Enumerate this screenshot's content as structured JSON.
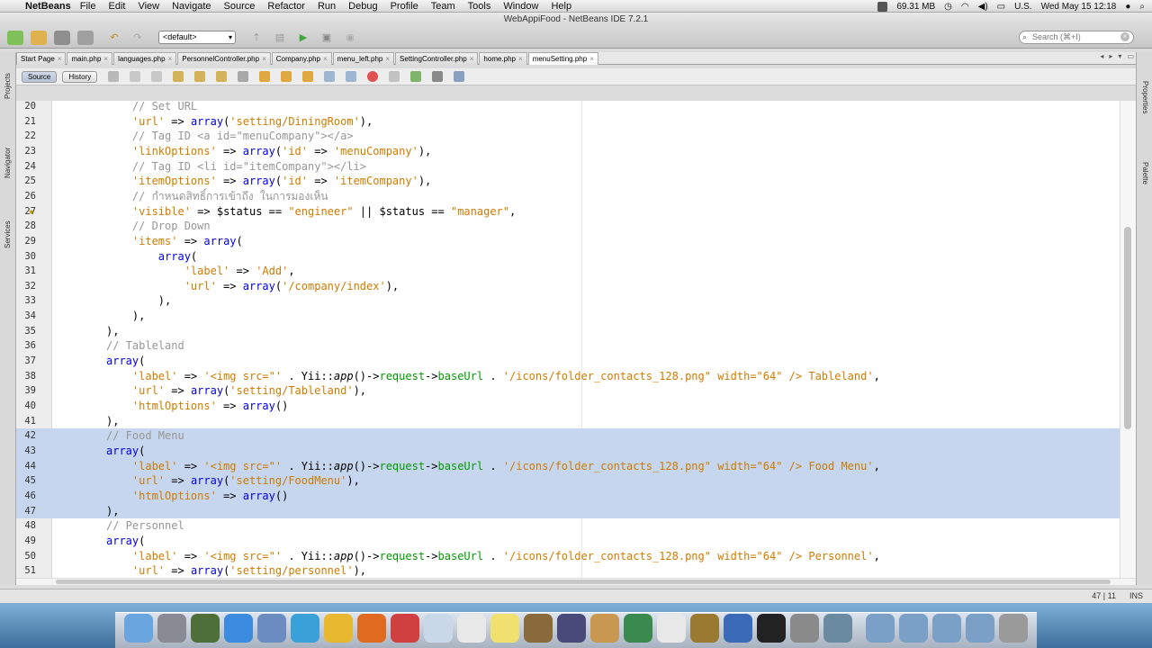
{
  "menubar": {
    "app_name": "NetBeans",
    "items": [
      "File",
      "Edit",
      "View",
      "Navigate",
      "Source",
      "Refactor",
      "Run",
      "Debug",
      "Profile",
      "Team",
      "Tools",
      "Window",
      "Help"
    ],
    "memory": "69.31 MB",
    "locale": "U.S.",
    "clock": "Wed May 15  12:18"
  },
  "window": {
    "title": "WebAppiFood - NetBeans IDE 7.2.1"
  },
  "toolbar": {
    "config": "<default>",
    "search_placeholder": "Search (⌘+I)"
  },
  "tabs": [
    "Start Page",
    "main.php",
    "languages.php",
    "PersonnelController.php",
    "Company.php",
    "menu_left.php",
    "SettingController.php",
    "home.php",
    "menuSetting.php"
  ],
  "active_tab": "menuSetting.php",
  "source_bar": {
    "source": "Source",
    "history": "History"
  },
  "side_panels": {
    "left": [
      "Projects",
      "Navigator",
      "Services"
    ],
    "right": [
      "Properties",
      "Palette"
    ]
  },
  "editor": {
    "lines": [
      {
        "n": "20",
        "code": "    // Set URL"
      },
      {
        "n": "21",
        "code": "    'url' => array('setting/DiningRoom'),"
      },
      {
        "n": "22",
        "code": "    // Tag ID <a id=\"menuCompany\"></a>"
      },
      {
        "n": "23",
        "code": "    'linkOptions' => array('id' => 'menuCompany'),"
      },
      {
        "n": "24",
        "code": "    // Tag ID <li id=\"itemCompany\"></li>"
      },
      {
        "n": "25",
        "code": "    'itemOptions' => array('id' => 'itemCompany'),"
      },
      {
        "n": "26",
        "code": "    // กำหนดสิทธิ์การเข้าถึง ในการมองเห็น"
      },
      {
        "n": "27",
        "code": "    'visible' => $status == \"engineer\" || $status == \"manager\","
      },
      {
        "n": "28",
        "code": "    // Drop Down"
      },
      {
        "n": "29",
        "code": "    'items' => array("
      },
      {
        "n": "30",
        "code": "        array("
      },
      {
        "n": "31",
        "code": "            'label' => 'Add',"
      },
      {
        "n": "32",
        "code": "            'url' => array('/company/index'),"
      },
      {
        "n": "33",
        "code": "        ),"
      },
      {
        "n": "34",
        "code": "    ),"
      },
      {
        "n": "35",
        "code": "),"
      },
      {
        "n": "36",
        "code": "// Tableland"
      },
      {
        "n": "37",
        "code": "array("
      },
      {
        "n": "38",
        "code": "    'label' => '<img src=\"' . Yii::app()->request->baseUrl . '/icons/folder_contacts_128.png\" width=\"64\" /> Tableland',"
      },
      {
        "n": "39",
        "code": "    'url' => array('setting/Tableland'),"
      },
      {
        "n": "40",
        "code": "    'htmlOptions' => array()"
      },
      {
        "n": "41",
        "code": "),"
      },
      {
        "n": "42",
        "code": "// Food Menu"
      },
      {
        "n": "43",
        "code": "array("
      },
      {
        "n": "44",
        "code": "    'label' => '<img src=\"' . Yii::app()->request->baseUrl . '/icons/folder_contacts_128.png\" width=\"64\" /> Food Menu',"
      },
      {
        "n": "45",
        "code": "    'url' => array('setting/FoodMenu'),"
      },
      {
        "n": "46",
        "code": "    'htmlOptions' => array()"
      },
      {
        "n": "47",
        "code": "),"
      },
      {
        "n": "48",
        "code": "// Personnel"
      },
      {
        "n": "49",
        "code": "array("
      },
      {
        "n": "50",
        "code": "    'label' => '<img src=\"' . Yii::app()->request->baseUrl . '/icons/folder_contacts_128.png\" width=\"64\" /> Personnel',"
      },
      {
        "n": "51",
        "code": "    'url' => array('setting/personnel'),"
      }
    ],
    "selected_lines": [
      "42",
      "43",
      "44",
      "45",
      "46",
      "47"
    ]
  },
  "status": {
    "position": "47 | 11",
    "mode": "INS"
  },
  "dock": {
    "icons": [
      "finder-icon",
      "launchpad-icon",
      "activity-monitor-icon",
      "app-store-icon",
      "preview-icon",
      "safari-icon",
      "chrome-icon",
      "firefox-icon",
      "mail-icon",
      "cube-icon",
      "calendar-icon",
      "stickies-icon",
      "photo-icon",
      "pen-icon",
      "keynote-icon",
      "charts-icon",
      "textedit-icon",
      "imovie-icon",
      "network-icon",
      "terminal-icon",
      "system-prefs-icon",
      "image-capture-icon",
      "folder-icon",
      "folder-icon",
      "folder-icon",
      "downloads-icon",
      "trash-icon"
    ]
  }
}
